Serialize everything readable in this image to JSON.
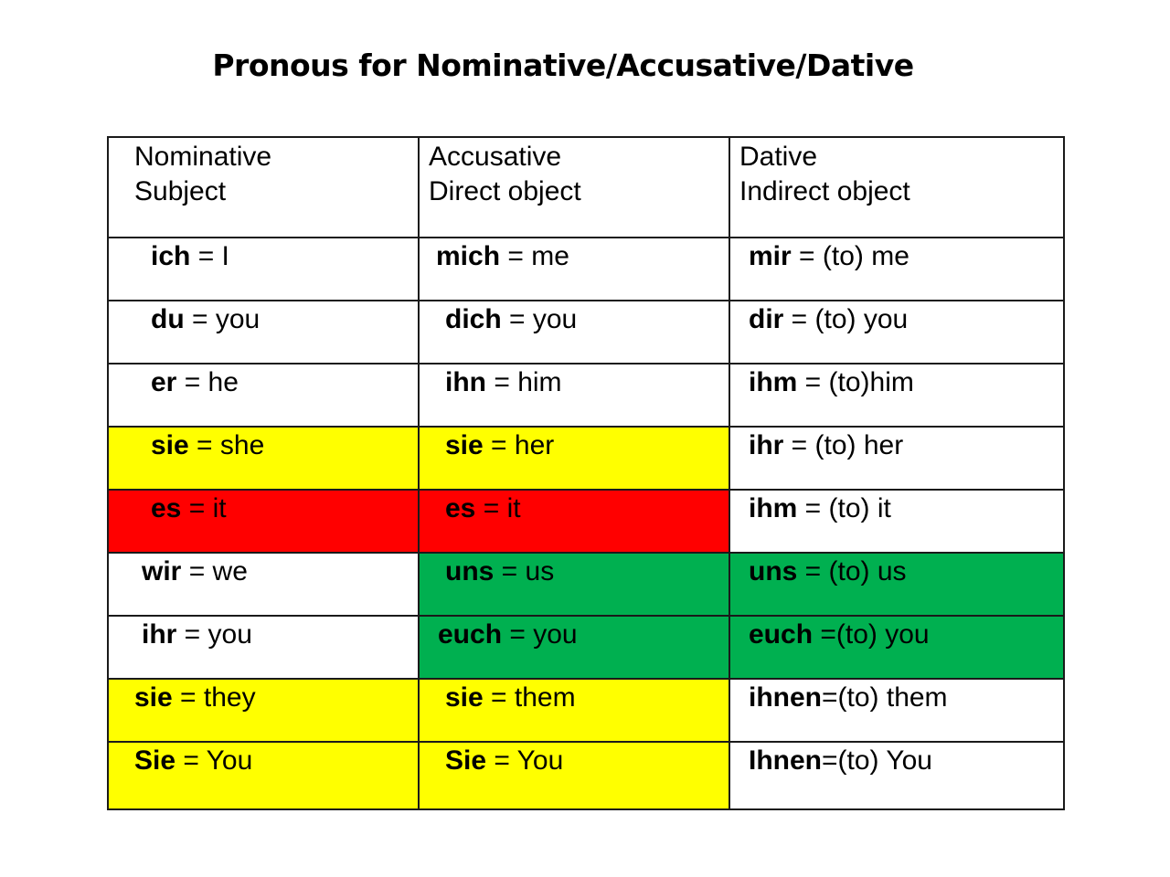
{
  "title": "Pronous for Nominative/Accusative/Dative",
  "colors": {
    "yellow": "#ffff00",
    "red": "#ff0000",
    "green": "#00b050",
    "white": "#ffffff"
  },
  "headers": [
    {
      "line1": "Nominative",
      "line2": "Subject"
    },
    {
      "line1": "Accusative",
      "line2": "Direct object"
    },
    {
      "line1": "Dative",
      "line2": "Indirect object"
    }
  ],
  "rows": [
    [
      {
        "pronoun": "ich",
        "rest": " = I",
        "bg": "white"
      },
      {
        "pronoun": "mich",
        "rest": " = me",
        "bg": "white"
      },
      {
        "pronoun": "mir",
        "rest": " = (to) me",
        "bg": "white"
      }
    ],
    [
      {
        "pronoun": "du",
        "rest": " = you",
        "bg": "white"
      },
      {
        "pronoun": "dich",
        "rest": " = you",
        "bg": "white"
      },
      {
        "pronoun": "dir",
        "rest": " = (to) you",
        "bg": "white"
      }
    ],
    [
      {
        "pronoun": "er",
        "rest": " = he",
        "bg": "white"
      },
      {
        "pronoun": "ihn",
        "rest": " = him",
        "bg": "white"
      },
      {
        "pronoun": "ihm",
        "rest": " = (to)him",
        "bg": "white"
      }
    ],
    [
      {
        "pronoun": "sie",
        "rest": " = she",
        "bg": "yellow"
      },
      {
        "pronoun": "sie",
        "rest": " = her",
        "bg": "yellow"
      },
      {
        "pronoun": "ihr",
        "rest": " = (to) her",
        "bg": "white"
      }
    ],
    [
      {
        "pronoun": "es",
        "rest": " = it",
        "bg": "red"
      },
      {
        "pronoun": "es",
        "rest": " = it",
        "bg": "red"
      },
      {
        "pronoun": "ihm",
        "rest": " = (to) it",
        "bg": "white"
      }
    ],
    [
      {
        "pronoun": "wir",
        "rest": " = we",
        "bg": "white"
      },
      {
        "pronoun": "uns",
        "rest": " = us",
        "bg": "green"
      },
      {
        "pronoun": "uns",
        "rest": " = (to) us",
        "bg": "green"
      }
    ],
    [
      {
        "pronoun": "ihr",
        "rest": " = you",
        "bg": "white"
      },
      {
        "pronoun": "euch",
        "rest": " = you",
        "bg": "green"
      },
      {
        "pronoun": "euch",
        "rest": " =(to) you",
        "bg": "green"
      }
    ],
    [
      {
        "pronoun": "sie",
        "rest": " = they",
        "bg": "yellow"
      },
      {
        "pronoun": "sie",
        "rest": " = them",
        "bg": "yellow"
      },
      {
        "pronoun": "ihnen",
        "rest": "=(to) them",
        "bg": "white"
      }
    ],
    [
      {
        "pronoun": "Sie",
        "rest": " = You",
        "bg": "yellow"
      },
      {
        "pronoun": "Sie",
        "rest": " = You",
        "bg": "yellow"
      },
      {
        "pronoun": "Ihnen",
        "rest": "=(to) You",
        "bg": "white"
      }
    ]
  ]
}
